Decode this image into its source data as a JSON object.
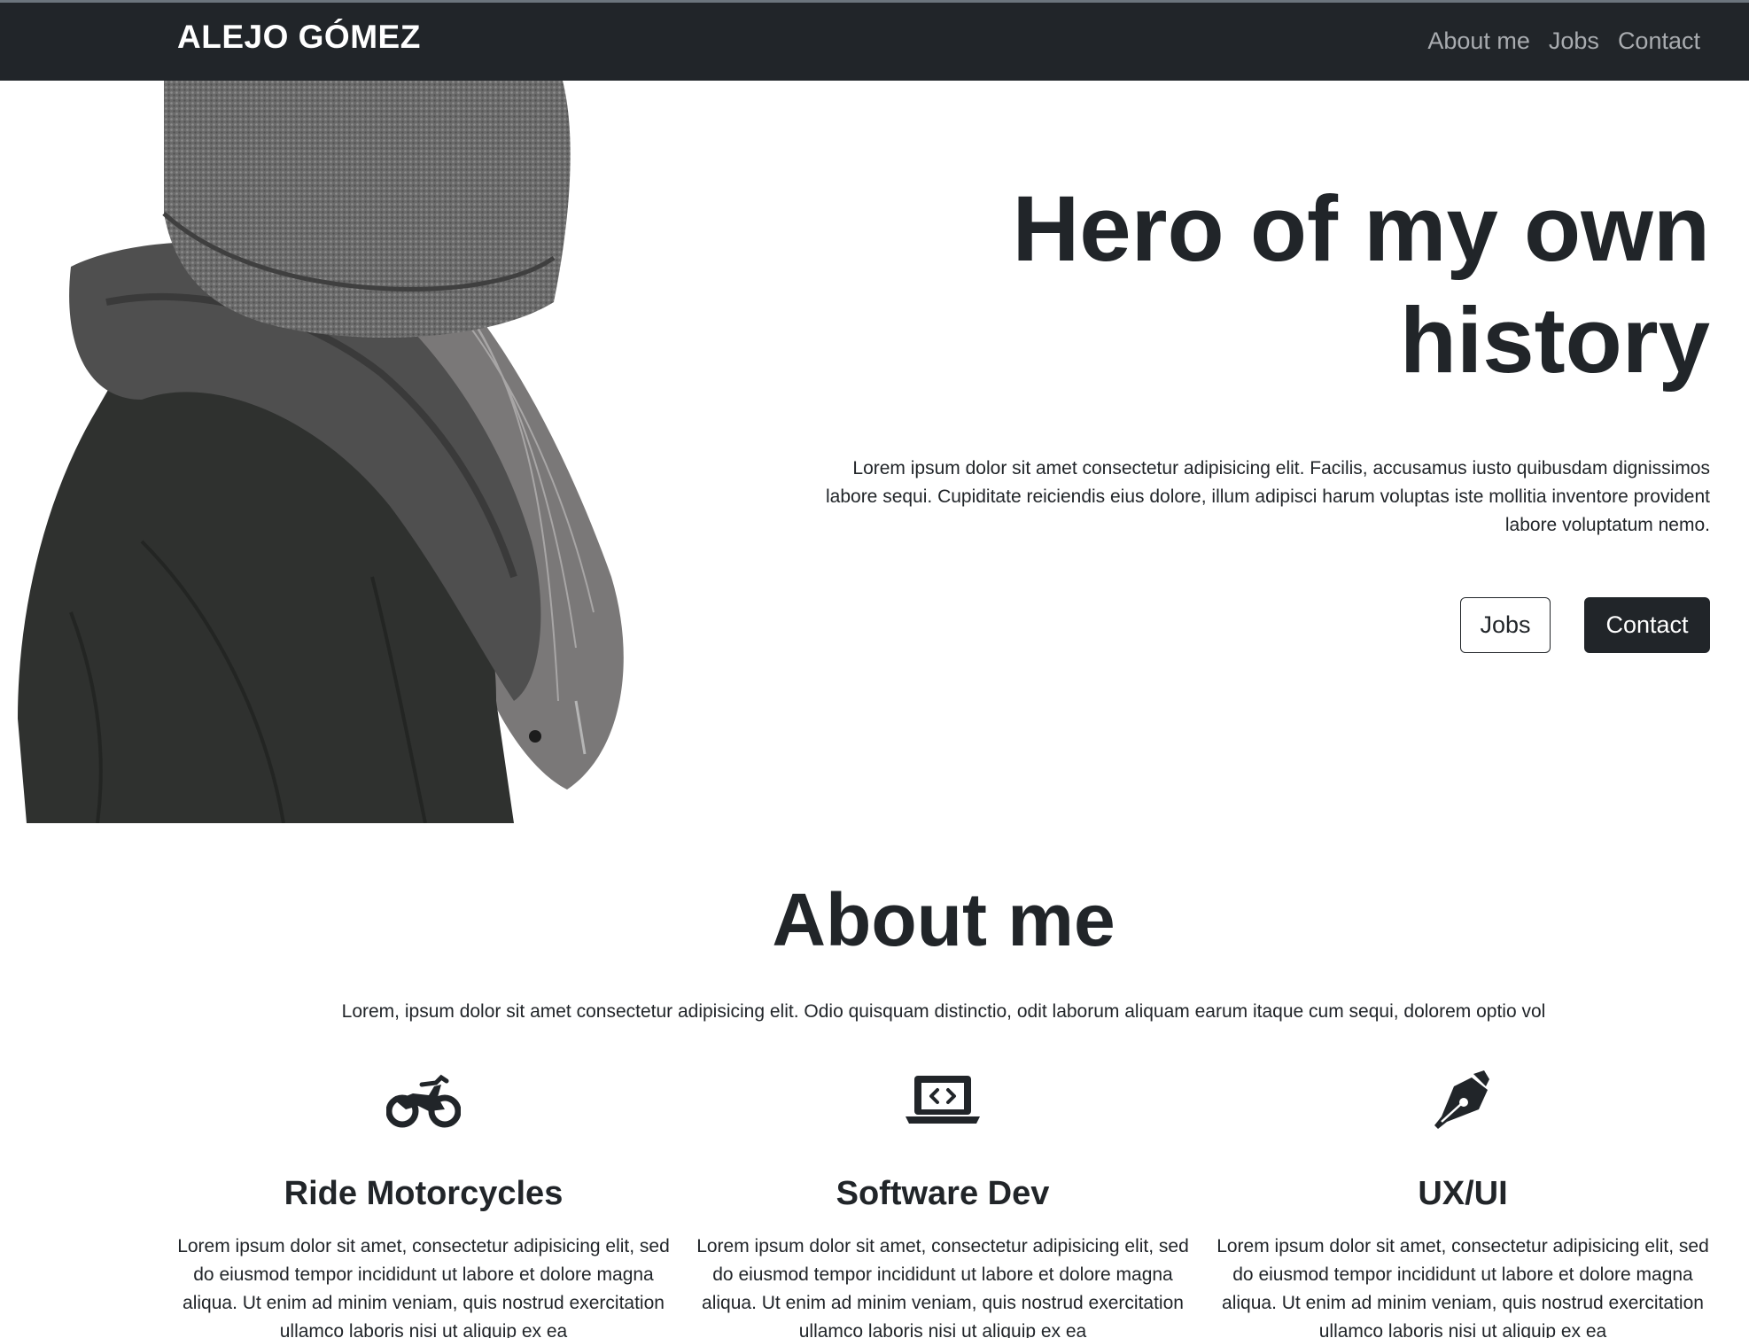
{
  "navbar": {
    "brand": "ALEJO GÓMEZ",
    "links": [
      "About me",
      "Jobs",
      "Contact"
    ]
  },
  "hero": {
    "title_line1": "Hero of my own",
    "title_line2": "history",
    "text": "Lorem ipsum dolor sit amet consectetur adipisicing elit. Facilis, accusamus iusto quibusdam dignissimos labore sequi. Cupiditate reiciendis eius dolore, illum adipisci harum voluptas iste mollitia inventore provident labore voluptatum nemo.",
    "buttons": {
      "jobs": "Jobs",
      "contact": "Contact"
    }
  },
  "about": {
    "title": "About me",
    "text": "Lorem, ipsum dolor sit amet consectetur adipisicing elit. Odio quisquam distinctio, odit laborum aliquam earum itaque cum sequi, dolorem optio vol",
    "features": [
      {
        "icon": "motorcycle-icon",
        "title": "Ride Motorcycles",
        "text": "Lorem ipsum dolor sit amet, consectetur adipisicing elit, sed do eiusmod tempor incididunt ut labore et dolore magna aliqua. Ut enim ad minim veniam, quis nostrud exercitation ullamco laboris nisi ut aliquip ex ea"
      },
      {
        "icon": "laptop-code-icon",
        "title": "Software Dev",
        "text": "Lorem ipsum dolor sit amet, consectetur adipisicing elit, sed do eiusmod tempor incididunt ut labore et dolore magna aliqua. Ut enim ad minim veniam, quis nostrud exercitation ullamco laboris nisi ut aliquip ex ea"
      },
      {
        "icon": "pen-nib-icon",
        "title": "UX/UI",
        "text": "Lorem ipsum dolor sit amet, consectetur adipisicing elit, sed do eiusmod tempor incididunt ut labore et dolore magna aliqua. Ut enim ad minim veniam, quis nostrud exercitation ullamco laboris nisi ut aliquip ex ea"
      }
    ]
  }
}
